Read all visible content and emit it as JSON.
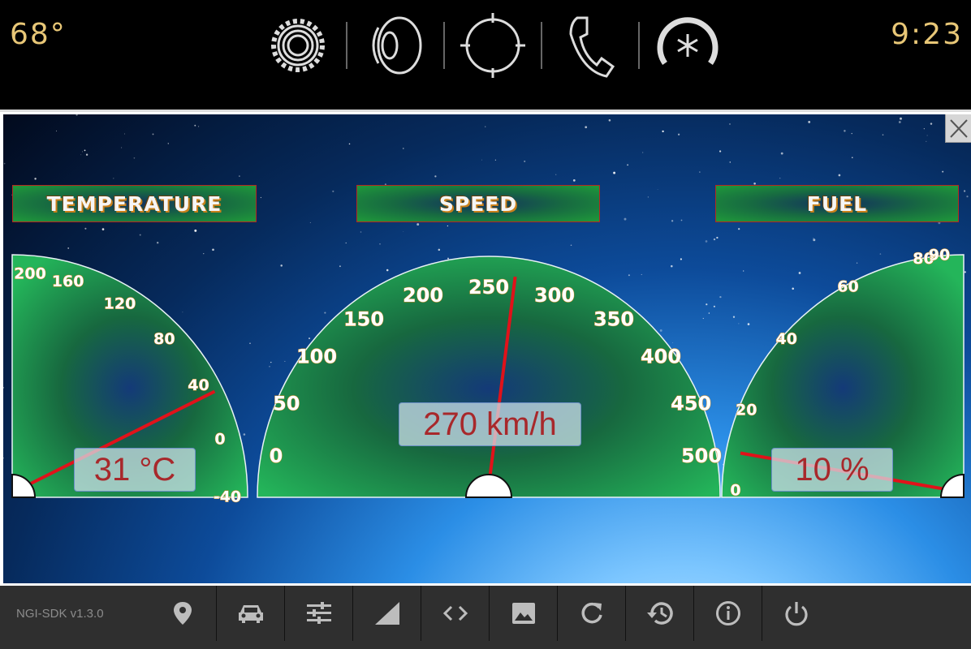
{
  "header": {
    "outside_temp": "68°",
    "clock": "9:23",
    "icons": [
      "gear-icon",
      "speaker-icon",
      "navigation-icon",
      "phone-icon",
      "climate-icon"
    ]
  },
  "gauges": {
    "temperature": {
      "title": "TEMPERATURE",
      "ticks": [
        "200",
        "160",
        "120",
        "80",
        "40",
        "0",
        "-40"
      ],
      "readout": "31 °C",
      "value": 31,
      "min": -40,
      "max": 200
    },
    "speed": {
      "title": "SPEED",
      "ticks": [
        "0",
        "50",
        "100",
        "150",
        "200",
        "250",
        "300",
        "350",
        "400",
        "450",
        "500"
      ],
      "readout": "270 km/h",
      "value": 270,
      "min": 0,
      "max": 500
    },
    "fuel": {
      "title": "FUEL",
      "ticks": [
        "0",
        "20",
        "40",
        "60",
        "80",
        "90"
      ],
      "readout": "10 %",
      "value": 10,
      "min": 0,
      "max": 90
    }
  },
  "footer": {
    "sdk_version": "NGI-SDK v1.3.0",
    "icons": [
      "location-icon",
      "car-icon",
      "settings-sliders-icon",
      "signal-icon",
      "code-icon",
      "image-icon",
      "refresh-icon",
      "history-icon",
      "info-icon",
      "power-icon"
    ]
  },
  "colors": {
    "accent": "#e8c777",
    "needle": "#e0121a",
    "readout_text": "#a8282b",
    "gauge_green": "#1f9a3a"
  }
}
